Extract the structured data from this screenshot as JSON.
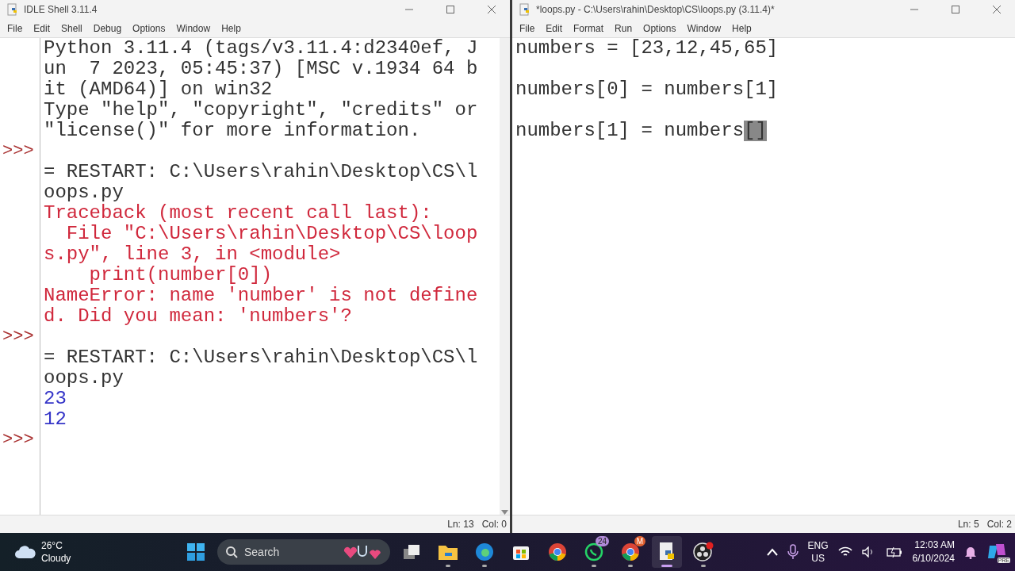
{
  "shell": {
    "title": "IDLE Shell 3.11.4",
    "menu": [
      "File",
      "Edit",
      "Shell",
      "Debug",
      "Options",
      "Window",
      "Help"
    ],
    "lines": [
      {
        "kind": "stdout",
        "text": "Python 3.11.4 (tags/v3.11.4:d2340ef, J"
      },
      {
        "kind": "stdout",
        "text": "un  7 2023, 05:45:37) [MSC v.1934 64 b"
      },
      {
        "kind": "stdout",
        "text": "it (AMD64)] on win32"
      },
      {
        "kind": "stdout",
        "text": "Type \"help\", \"copyright\", \"credits\" or"
      },
      {
        "kind": "stdout",
        "text": "\"license()\" for more information."
      },
      {
        "kind": "prompt",
        "prompt": ">>>"
      },
      {
        "kind": "stdout",
        "text": "= RESTART: C:\\Users\\rahin\\Desktop\\CS\\l"
      },
      {
        "kind": "stdout",
        "text": "oops.py"
      },
      {
        "kind": "error",
        "text": "Traceback (most recent call last):"
      },
      {
        "kind": "error",
        "text": "  File \"C:\\Users\\rahin\\Desktop\\CS\\loop"
      },
      {
        "kind": "error",
        "text": "s.py\", line 3, in <module>"
      },
      {
        "kind": "error",
        "text": "    print(number[0])"
      },
      {
        "kind": "error",
        "text": "NameError: name 'number' is not define"
      },
      {
        "kind": "error",
        "text": "d. Did you mean: 'numbers'?"
      },
      {
        "kind": "prompt",
        "prompt": ">>>"
      },
      {
        "kind": "stdout",
        "text": "= RESTART: C:\\Users\\rahin\\Desktop\\CS\\l"
      },
      {
        "kind": "stdout",
        "text": "oops.py"
      },
      {
        "kind": "result",
        "text": "23"
      },
      {
        "kind": "result",
        "text": "12"
      },
      {
        "kind": "prompt",
        "prompt": ">>>"
      }
    ],
    "status": {
      "line": "Ln: 13",
      "col": "Col: 0"
    }
  },
  "editor": {
    "title": "*loops.py - C:\\Users\\rahin\\Desktop\\CS\\loops.py (3.11.4)*",
    "menu": [
      "File",
      "Edit",
      "Format",
      "Run",
      "Options",
      "Window",
      "Help"
    ],
    "lines": [
      {
        "kind": "code",
        "text": "numbers = [23,12,45,65]"
      },
      {
        "kind": "blank"
      },
      {
        "kind": "code",
        "text": "numbers[0] = numbers[1]"
      },
      {
        "kind": "blank"
      },
      {
        "kind": "code",
        "text": "numbers[1] = numbers",
        "match": "[]"
      }
    ],
    "status": {
      "line": "Ln: 5",
      "col": "Col: 2"
    }
  },
  "taskbar": {
    "weather": {
      "temp": "26°C",
      "condition": "Cloudy"
    },
    "search": {
      "placeholder": "Search"
    },
    "apps": [
      {
        "kind": "start",
        "running": false,
        "active": false
      },
      {
        "kind": "taskview",
        "running": false,
        "active": false
      },
      {
        "kind": "files",
        "running": true,
        "active": false
      },
      {
        "kind": "edge",
        "running": true,
        "active": false
      },
      {
        "kind": "store",
        "running": false,
        "active": false
      },
      {
        "kind": "chrome",
        "running": false,
        "active": false
      },
      {
        "kind": "whatsapp",
        "running": true,
        "active": false,
        "badge": "24"
      },
      {
        "kind": "chrome",
        "running": true,
        "active": false,
        "badge": "M"
      },
      {
        "kind": "idle",
        "running": true,
        "active": true
      },
      {
        "kind": "obs",
        "running": true,
        "active": false
      }
    ],
    "language": {
      "primary": "ENG",
      "secondary": "US"
    },
    "time": "12:03 AM",
    "date": "6/10/2024",
    "copilot_badge": "PRE"
  }
}
